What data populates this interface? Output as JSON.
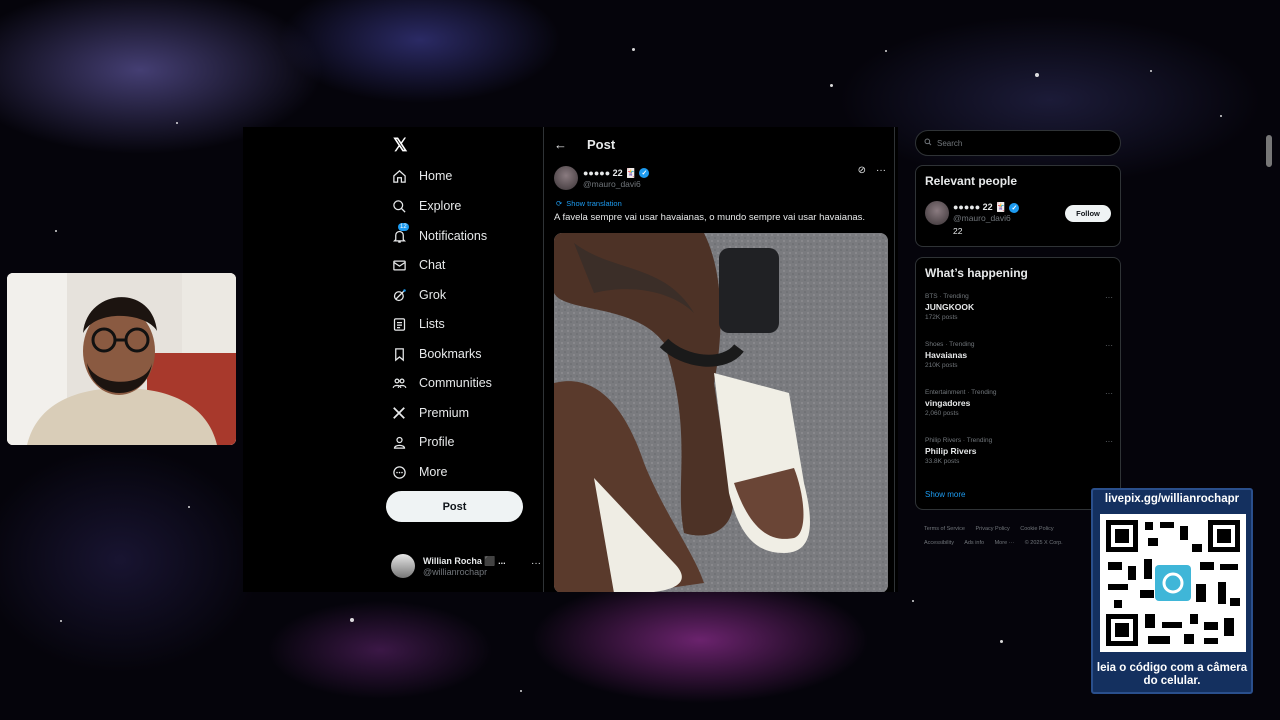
{
  "nav": {
    "items": [
      {
        "label": "Home",
        "icon": "home-icon"
      },
      {
        "label": "Explore",
        "icon": "search-icon"
      },
      {
        "label": "Notifications",
        "icon": "bell-icon",
        "badge": "12"
      },
      {
        "label": "Chat",
        "icon": "mail-icon"
      },
      {
        "label": "Grok",
        "icon": "grok-icon"
      },
      {
        "label": "Lists",
        "icon": "list-icon"
      },
      {
        "label": "Bookmarks",
        "icon": "bookmark-icon"
      },
      {
        "label": "Communities",
        "icon": "communities-icon"
      },
      {
        "label": "Premium",
        "icon": "x-logo-icon"
      },
      {
        "label": "Profile",
        "icon": "profile-icon"
      },
      {
        "label": "More",
        "icon": "more-circle-icon"
      }
    ],
    "post_button": "Post",
    "account": {
      "name": "Willian Rocha ⬛ ...",
      "handle": "@willianrochapr"
    }
  },
  "post": {
    "header_title": "Post",
    "author_name": "●●●●● 22 🃏",
    "author_handle": "@mauro_davi6",
    "show_translation": "Show translation",
    "text": "A favela sempre vai usar havaianas, o mundo sempre vai usar havaianas."
  },
  "sidebar": {
    "search_placeholder": "Search",
    "relevant_title": "Relevant people",
    "relevant_person": {
      "name": "●●●●● 22 🃏",
      "handle": "@mauro_davi6",
      "bio": "22",
      "follow_label": "Follow"
    },
    "happening_title": "What’s happening",
    "trends": [
      {
        "meta": "BTS · Trending",
        "name": "JUNGKOOK",
        "count": "172K posts"
      },
      {
        "meta": "Shoes · Trending",
        "name": "Havaianas",
        "count": "210K posts"
      },
      {
        "meta": "Entertainment · Trending",
        "name": "vingadores",
        "count": "2,060 posts"
      },
      {
        "meta": "Philip Rivers · Trending",
        "name": "Philip Rivers",
        "count": "33.8K posts"
      }
    ],
    "show_more": "Show more",
    "footer": [
      "Terms of Service",
      "Privacy Policy",
      "Cookie Policy",
      "Accessibility",
      "Ads info",
      "More ···",
      "© 2025 X Corp."
    ]
  },
  "overlay": {
    "livepix_url": "livepix.gg/willianrochapr",
    "livepix_caption": "leia o código com a câmera do celular."
  },
  "colors": {
    "accent": "#1d9bf0",
    "background": "#000000",
    "livepix_panel": "#14305f"
  }
}
